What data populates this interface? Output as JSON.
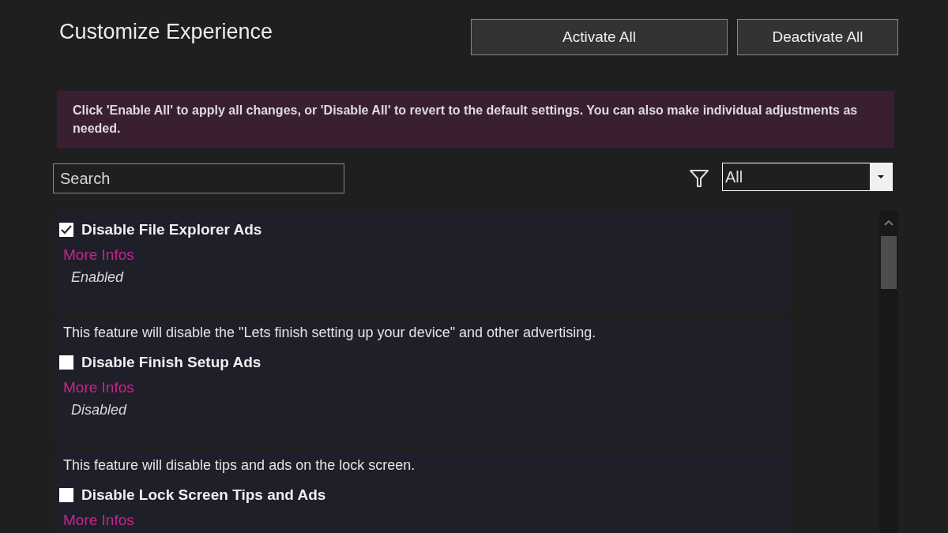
{
  "title": "Customize Experience",
  "buttons": [
    "Activate All",
    "Deactivate All"
  ],
  "info": "Click 'Enable All' to apply all changes, or 'Disable All' to revert to the default settings. You can also make individual adjustments as needed.",
  "search": {
    "placeholder": "Search"
  },
  "filter": {
    "value": "All"
  },
  "features": [
    {
      "name": "Disable File Explorer Ads",
      "checked": true,
      "link": "More Infos",
      "status": "Enabled"
    },
    {
      "description": "This feature will disable the \"Lets finish setting up your device\" and other advertising.",
      "name": "Disable Finish Setup Ads",
      "checked": false,
      "link": "More Infos",
      "status": "Disabled"
    },
    {
      "description": "This feature will disable tips and ads on the lock screen.",
      "name": "Disable Lock Screen Tips and Ads",
      "checked": false,
      "link": "More Infos"
    }
  ]
}
